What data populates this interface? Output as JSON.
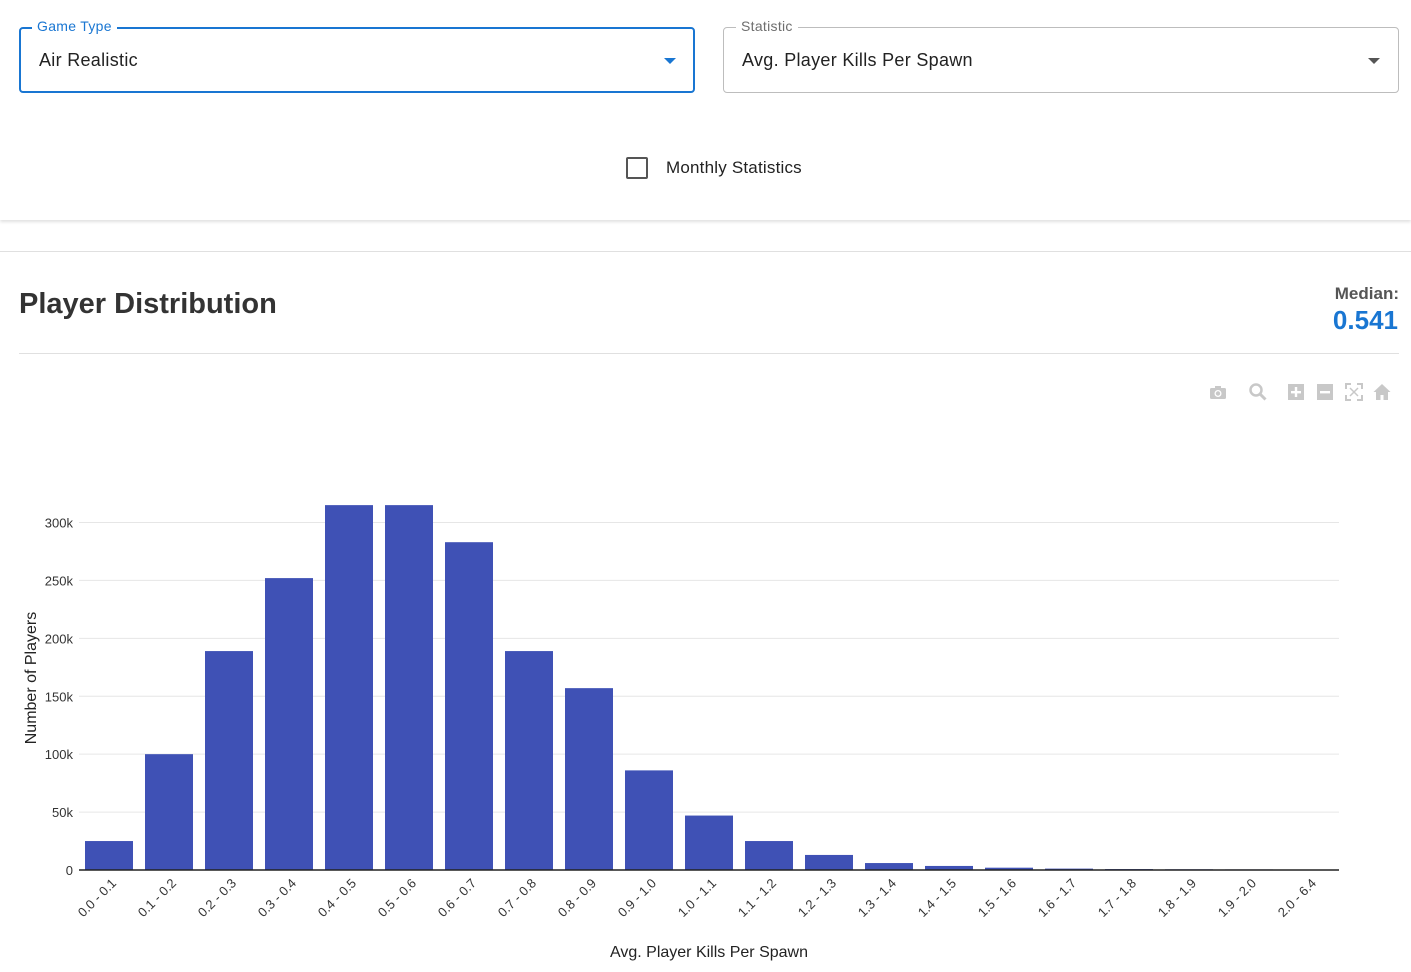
{
  "filters": {
    "game_type": {
      "label": "Game Type",
      "value": "Air Realistic"
    },
    "statistic": {
      "label": "Statistic",
      "value": "Avg. Player Kills Per Spawn"
    },
    "monthly": {
      "label": "Monthly Statistics",
      "checked": false
    }
  },
  "section": {
    "title": "Player Distribution",
    "median_label": "Median:",
    "median_value": "0.541"
  },
  "modebar": [
    "camera-icon",
    "zoom-icon",
    "zoom-in-icon",
    "zoom-out-icon",
    "autoscale-icon",
    "home-icon"
  ],
  "colors": {
    "accent": "#1976d2",
    "bar": "#3f51b5"
  },
  "chart_data": {
    "type": "bar",
    "categories": [
      "0.0 - 0.1",
      "0.1 - 0.2",
      "0.2 - 0.3",
      "0.3 - 0.4",
      "0.4 - 0.5",
      "0.5 - 0.6",
      "0.6 - 0.7",
      "0.7 - 0.8",
      "0.8 - 0.9",
      "0.9 - 1.0",
      "1.0 - 1.1",
      "1.1 - 1.2",
      "1.2 - 1.3",
      "1.3 - 1.4",
      "1.4 - 1.5",
      "1.5 - 1.6",
      "1.6 - 1.7",
      "1.7 - 1.8",
      "1.8 - 1.9",
      "1.9 - 2.0",
      "2.0 - 6.4"
    ],
    "values": [
      25000,
      100000,
      189000,
      252000,
      315000,
      315000,
      283000,
      189000,
      157000,
      86000,
      47000,
      25000,
      13000,
      6000,
      3500,
      2000,
      1200,
      800,
      600,
      500,
      400
    ],
    "xlabel": "Avg. Player Kills Per Spawn",
    "ylabel": "Number of Players",
    "yticks": [
      0,
      50000,
      100000,
      150000,
      200000,
      250000,
      300000
    ],
    "ytick_labels": [
      "0",
      "50k",
      "100k",
      "150k",
      "200k",
      "250k",
      "300k"
    ],
    "ylim": [
      0,
      332000
    ],
    "grid": true
  }
}
